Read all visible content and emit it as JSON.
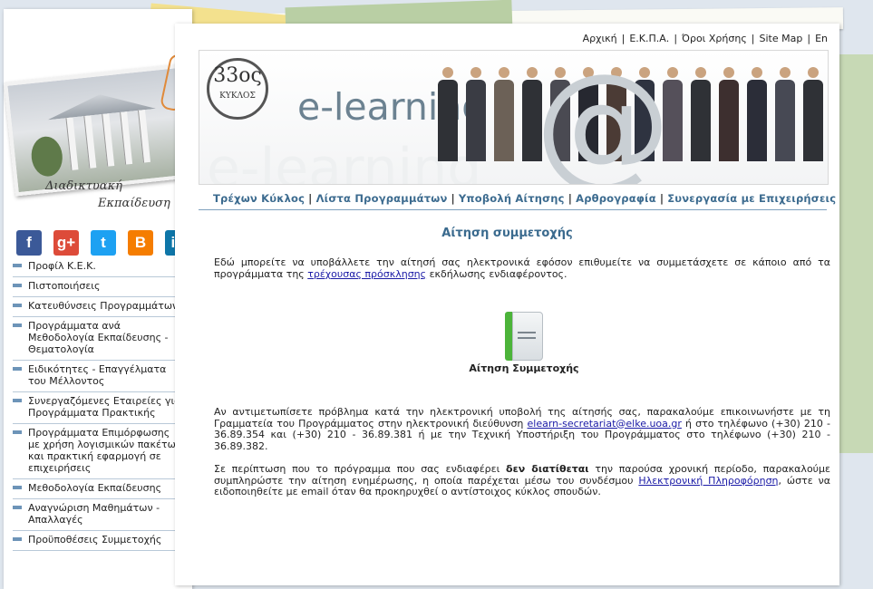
{
  "sidebar": {
    "script_line1": "Διαδικτυακή",
    "script_line2": "Εκπαίδευση",
    "social": [
      {
        "name": "facebook",
        "glyph": "f",
        "color": "#3b5998"
      },
      {
        "name": "google-plus",
        "glyph": "g+",
        "color": "#dd4b39"
      },
      {
        "name": "twitter",
        "glyph": "t",
        "color": "#1da1f2"
      },
      {
        "name": "blogger",
        "glyph": "B",
        "color": "#f57d00"
      },
      {
        "name": "linkedin",
        "glyph": "in",
        "color": "#0e76a8"
      }
    ],
    "menu": [
      "Προφίλ Κ.Ε.Κ.",
      "Πιστοποιήσεις",
      "Κατευθύνσεις Προγραμμάτων",
      "Προγράμματα ανά Μεθοδολογία Εκπαίδευσης - Θεματολογία",
      "Ειδικότητες - Επαγγέλματα του Μέλλοντος",
      "Συνεργαζόμενες Εταιρείες για Προγράμματα Πρακτικής",
      "Προγράμματα Επιμόρφωσης με χρήση λογισμικών πακέτων και πρακτική εφαρμογή σε επιχειρήσεις",
      "Μεθοδολογία Εκπαίδευσης",
      "Αναγνώριση Μαθημάτων - Απαλλαγές",
      "Προϋποθέσεις Συμμετοχής"
    ]
  },
  "top_links": [
    "Αρχική",
    "Ε.Κ.Π.Α.",
    "Όροι Χρήσης",
    "Site Map",
    "En"
  ],
  "banner": {
    "badge_num": "33ος",
    "badge_label": "ΚΥΚΛΟΣ",
    "logo_text": "e-learning",
    "at_glyph": "@"
  },
  "subnav": [
    "Τρέχων Κύκλος",
    "Λίστα Προγραμμάτων",
    "Υποβολή Αίτησης",
    "Αρθρογραφία",
    "Συνεργασία με Επιχειρήσεις"
  ],
  "content": {
    "title": "Αίτηση συμμετοχής",
    "intro_before": "Εδώ μπορείτε να υποβάλλετε την αίτησή σας ηλεκτρονικά εφόσον επιθυμείτε να συμμετάσχετε σε κάποιο από τα προγράμματα της ",
    "intro_link": "τρέχουσας πρόσκλησης",
    "intro_after": " εκδήλωσης ενδιαφέροντος.",
    "apply_label": "Αίτηση Συμμετοχής",
    "problem_1": "Αν αντιμετωπίσετε πρόβλημα κατά την ηλεκτρονική υποβολή της αίτησής σας, παρακαλούμε επικοινωνήστε με τη Γραμματεία του Προγράμματος στην ηλεκτρονική διεύθυνση ",
    "problem_email": "elearn-secretariat@elke.uoa.gr",
    "problem_2": " ή στο τηλέφωνο (+30) 210 - 36.89.354 και (+30) 210 - 36.89.381 ή με την Τεχνική Υποστήριξη του Προγράμματος στο τηλέφωνο (+30) 210 - 36.89.382.",
    "notify_1": "Σε περίπτωση που το πρόγραμμα που σας ενδιαφέρει ",
    "notify_bold": "δεν διατίθεται",
    "notify_2": " την παρούσα χρονική περίοδο, παρακαλούμε συμπληρώστε την αίτηση ενημέρωσης, η οποία παρέχεται μέσω του συνδέσμου ",
    "notify_link": "Ηλεκτρονική Πληροφόρηση",
    "notify_3": ", ώστε να ειδοποιηθείτε με email όταν θα προκηρυχθεί ο αντίστοιχος κύκλος σπουδών."
  }
}
